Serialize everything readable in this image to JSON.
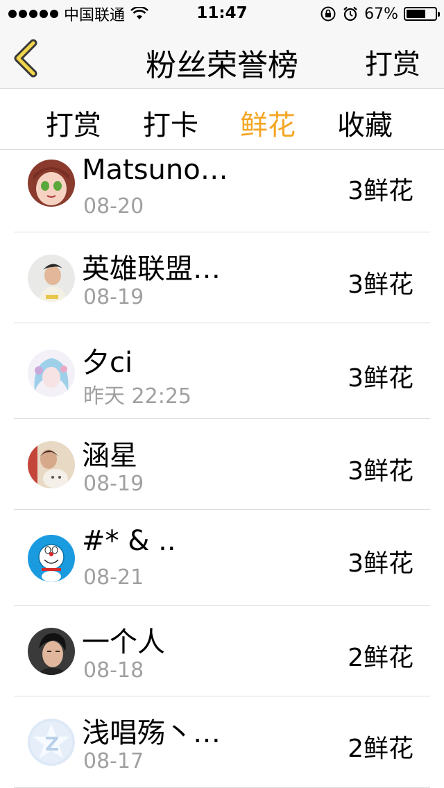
{
  "status_bar": {
    "carrier": "中国联通",
    "time": "11:47",
    "battery_percent": "67%",
    "battery_level": 0.67
  },
  "nav": {
    "title": "粉丝荣誉榜",
    "right_action": "打赏"
  },
  "tabs": [
    {
      "label": "打赏",
      "active": false
    },
    {
      "label": "打卡",
      "active": false
    },
    {
      "label": "鲜花",
      "active": true
    },
    {
      "label": "收藏",
      "active": false
    }
  ],
  "colors": {
    "accent": "#f5a623",
    "separator": "#dcdcdc",
    "secondary_text": "#a0a0a0"
  },
  "fans": [
    {
      "name": "Matsuno…",
      "date": "08-20",
      "amount": "3鲜花",
      "avatar_icon": "anime-girl-avatar"
    },
    {
      "name": "英雄联盟…",
      "date": "08-19",
      "amount": "3鲜花",
      "avatar_icon": "person-avatar"
    },
    {
      "name": "夕ci",
      "date": "昨天 22:25",
      "amount": "3鲜花",
      "avatar_icon": "anime-blue-hair-avatar"
    },
    {
      "name": "涵星",
      "date": "08-19",
      "amount": "3鲜花",
      "avatar_icon": "person-cat-avatar"
    },
    {
      "name": "#* & ..",
      "date": "08-21",
      "amount": "3鲜花",
      "avatar_icon": "doraemon-avatar"
    },
    {
      "name": "一个人",
      "date": "08-18",
      "amount": "2鲜花",
      "avatar_icon": "man-portrait-avatar"
    },
    {
      "name": "浅唱殇丶…",
      "date": "08-17",
      "amount": "2鲜花",
      "avatar_icon": "star-badge-avatar"
    }
  ]
}
